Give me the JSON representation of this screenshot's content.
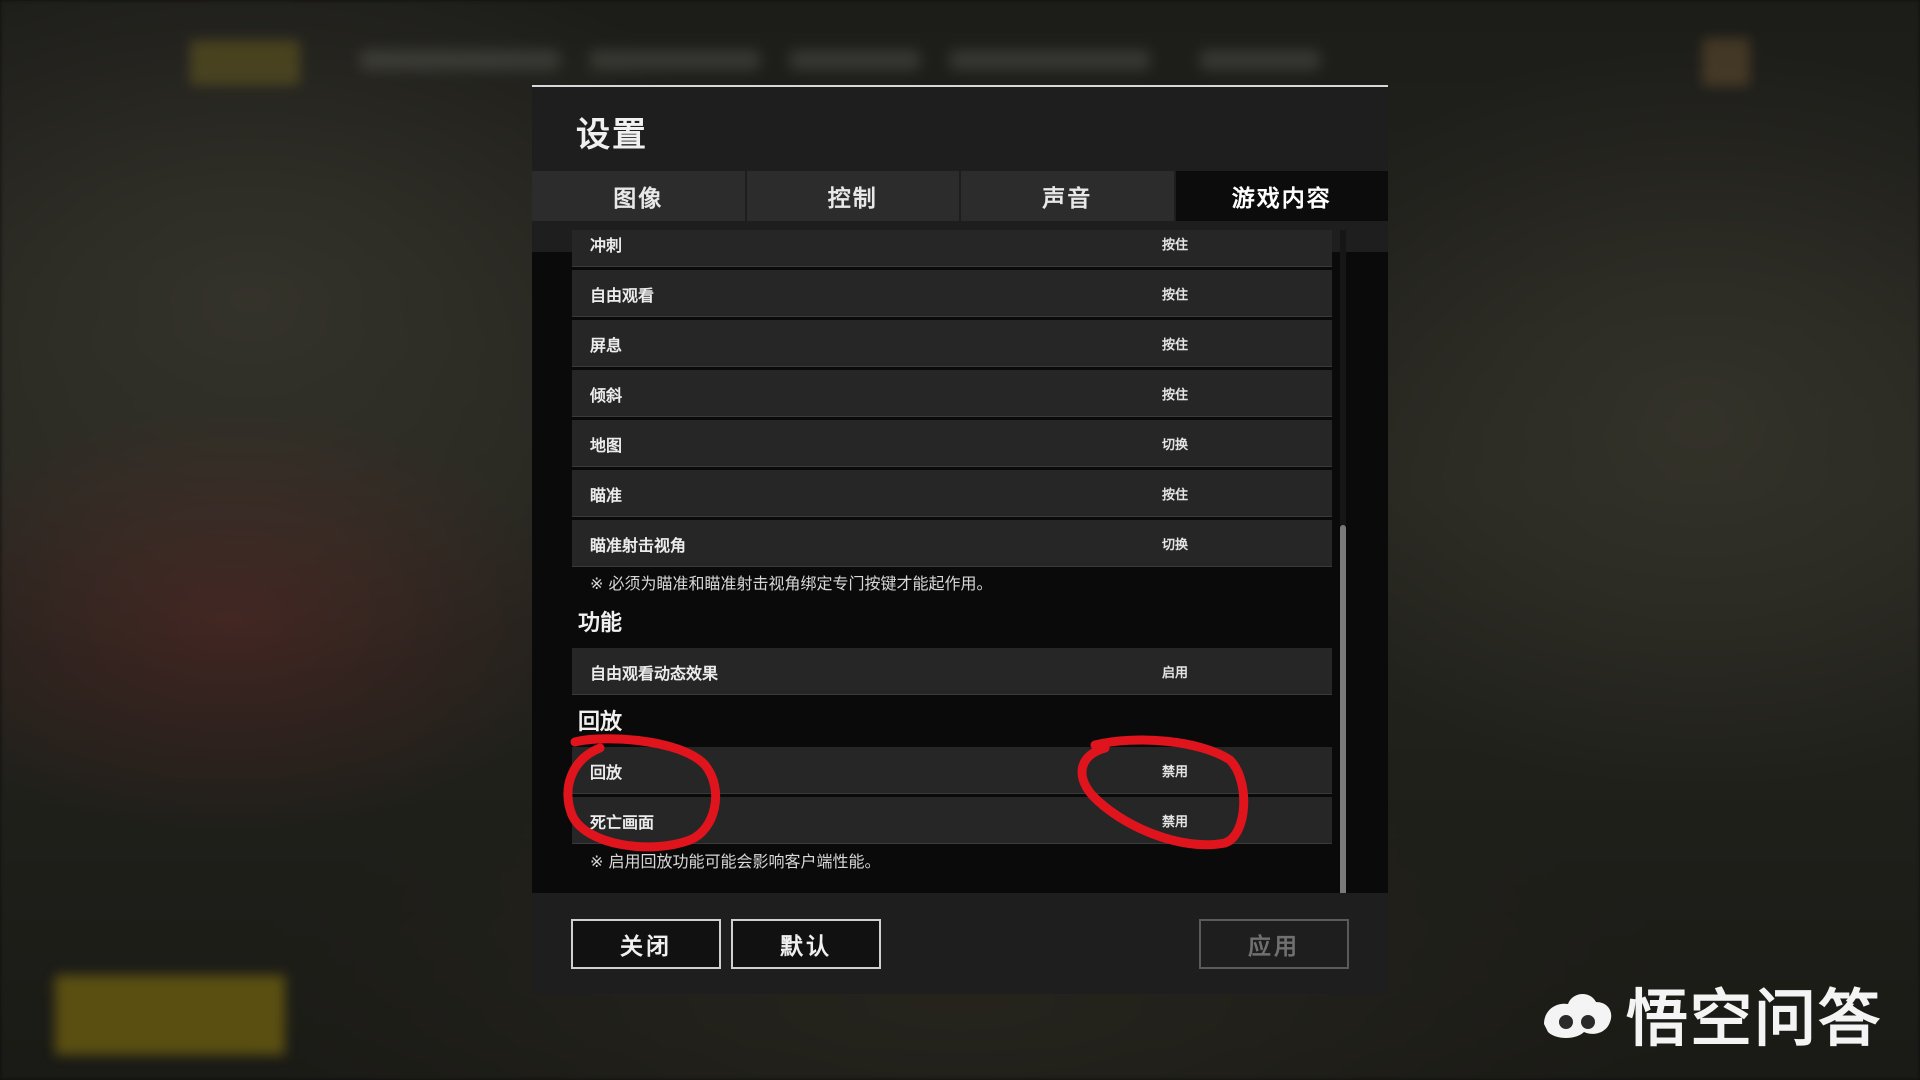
{
  "dialog": {
    "title": "设置",
    "tabs": [
      {
        "label": "图像",
        "active": false
      },
      {
        "label": "控制",
        "active": false
      },
      {
        "label": "声音",
        "active": false
      },
      {
        "label": "游戏内容",
        "active": true
      }
    ],
    "keybind_rows": [
      {
        "label": "冲刺",
        "value": "按住"
      },
      {
        "label": "自由观看",
        "value": "按住"
      },
      {
        "label": "屏息",
        "value": "按住"
      },
      {
        "label": "倾斜",
        "value": "按住"
      },
      {
        "label": "地图",
        "value": "切换"
      },
      {
        "label": "瞄准",
        "value": "按住"
      },
      {
        "label": "瞄准射击视角",
        "value": "切换"
      }
    ],
    "keybind_note": "※ 必须为瞄准和瞄准射击视角绑定专门按键才能起作用。",
    "function_section": {
      "title": "功能",
      "rows": [
        {
          "label": "自由观看动态效果",
          "value": "启用"
        }
      ]
    },
    "replay_section": {
      "title": "回放",
      "rows": [
        {
          "label": "回放",
          "value": "禁用"
        },
        {
          "label": "死亡画面",
          "value": "禁用"
        }
      ],
      "note": "※ 启用回放功能可能会影响客户端性能。"
    },
    "footer": {
      "close_label": "关闭",
      "default_label": "默认",
      "apply_label": "应用"
    }
  },
  "watermark": {
    "text": "悟空问答"
  },
  "colors": {
    "annotation": "#e0141c",
    "panel": "#262626",
    "dialog_bg": "#0a0a0a"
  }
}
